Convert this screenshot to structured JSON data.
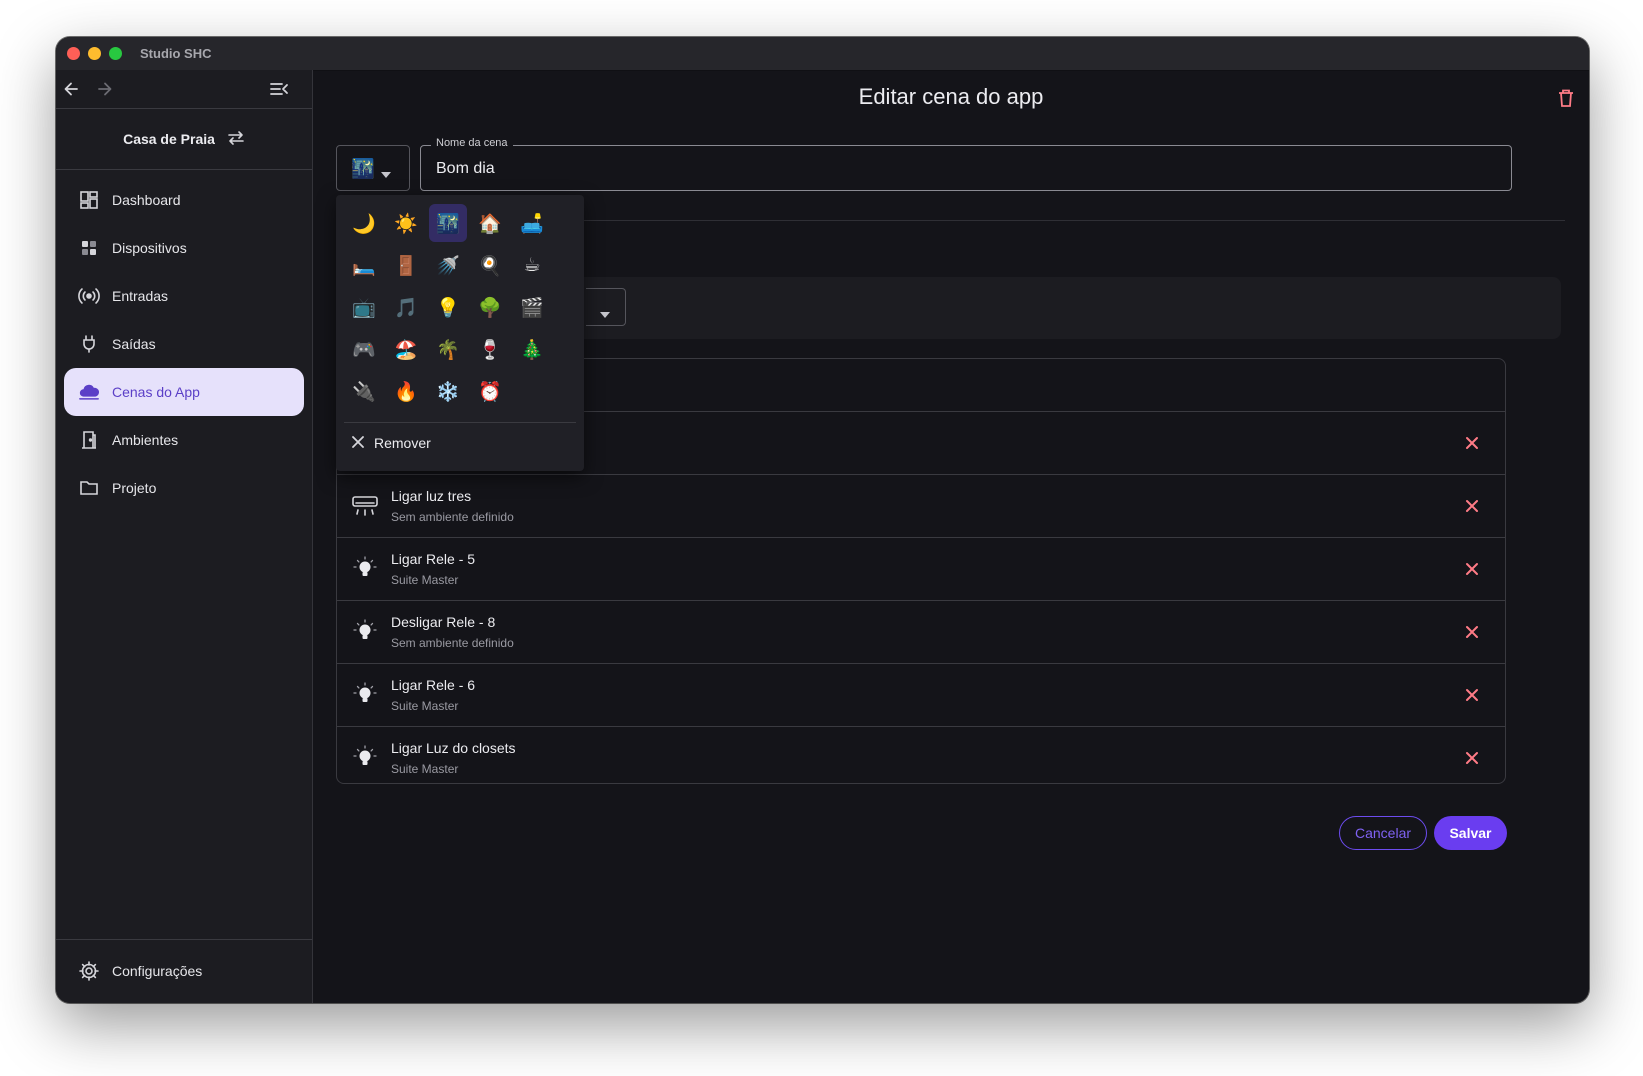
{
  "window": {
    "title": "Studio SHC"
  },
  "sidebar": {
    "project_name": "Casa de Praia",
    "items": [
      {
        "label": "Dashboard",
        "icon": "dashboard-icon",
        "active": false
      },
      {
        "label": "Dispositivos",
        "icon": "devices-icon",
        "active": false
      },
      {
        "label": "Entradas",
        "icon": "broadcast-icon",
        "active": false
      },
      {
        "label": "Saídas",
        "icon": "plug-icon",
        "active": false
      },
      {
        "label": "Cenas do App",
        "icon": "cloud-icon",
        "active": true
      },
      {
        "label": "Ambientes",
        "icon": "door-icon",
        "active": false
      },
      {
        "label": "Projeto",
        "icon": "folder-icon",
        "active": false
      }
    ],
    "settings_label": "Configurações"
  },
  "main": {
    "title": "Editar cena do app",
    "name_field": {
      "label": "Nome da cena",
      "value": "Bom dia"
    },
    "actions": [
      {
        "title": "Ligar luz tres",
        "subtitle": "Sem ambiente definido",
        "icon": "air-conditioner-icon"
      },
      {
        "title": "Ligar Rele - 5",
        "subtitle": "Suite Master",
        "icon": "lightbulb-icon"
      },
      {
        "title": "Desligar Rele - 8",
        "subtitle": "Sem ambiente definido",
        "icon": "lightbulb-icon"
      },
      {
        "title": "Ligar Rele - 6",
        "subtitle": "Suite Master",
        "icon": "lightbulb-icon"
      },
      {
        "title": "Ligar Luz do closets",
        "subtitle": "Suite Master",
        "icon": "lightbulb-icon"
      }
    ],
    "cancel_label": "Cancelar",
    "save_label": "Salvar"
  },
  "icon_picker": {
    "selected": "🌃",
    "icons": [
      "🌙",
      "☀️",
      "🌃",
      "🏠",
      "🛋️",
      "🛏️",
      "🚪",
      "🚿",
      "🍳",
      "☕",
      "📺",
      "🎵",
      "💡",
      "🌳",
      "🎬",
      "🎮",
      "🏖️",
      "🌴",
      "🍷",
      "🎄",
      "🔌",
      "🔥",
      "❄️",
      "⏰"
    ],
    "remove_label": "Remover"
  },
  "colors": {
    "accent": "#6a3df0",
    "active_bg": "#e6e1fb",
    "delete": "#ff7b86",
    "background": "#141419"
  }
}
